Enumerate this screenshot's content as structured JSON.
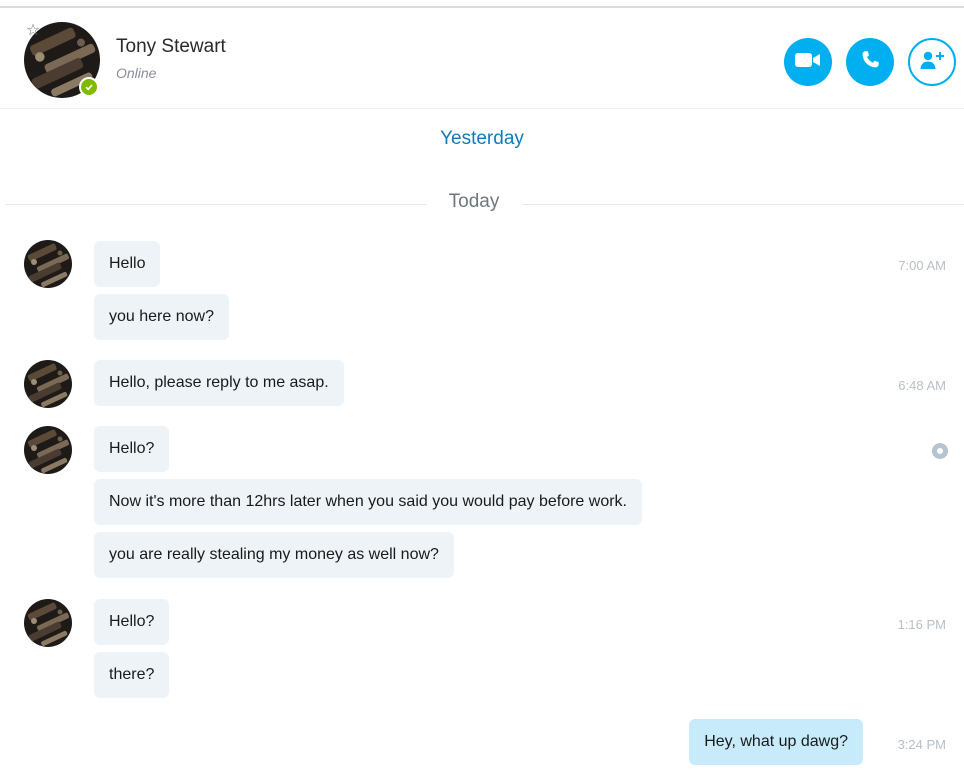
{
  "header": {
    "contact_name": "Tony Stewart",
    "contact_status": "Online",
    "buttons": {
      "video": "video-call-icon",
      "call": "phone-icon",
      "add": "add-contact-icon"
    }
  },
  "dividers": {
    "yesterday": "Yesterday",
    "today": "Today"
  },
  "messages": [
    {
      "text": "Hello",
      "time": "7:00 AM"
    },
    {
      "text": "you here now?"
    },
    {
      "text": "Hello, please reply to me asap.",
      "time": "6:48 AM"
    },
    {
      "text": "Hello?"
    },
    {
      "text": "Now it's more than 12hrs later when you said you would pay before work."
    },
    {
      "text": "you are really stealing my money as well now?"
    },
    {
      "text": "Hello?",
      "time": "1:16 PM"
    },
    {
      "text": "there?"
    },
    {
      "text": "Hey, what up dawg?",
      "time": "3:24 PM"
    }
  ],
  "colors": {
    "accent": "#00aff0",
    "online": "#7fba00",
    "link": "#0f7bbd",
    "bubble_in": "#eef3f8",
    "bubble_out": "#c7ebfb"
  }
}
